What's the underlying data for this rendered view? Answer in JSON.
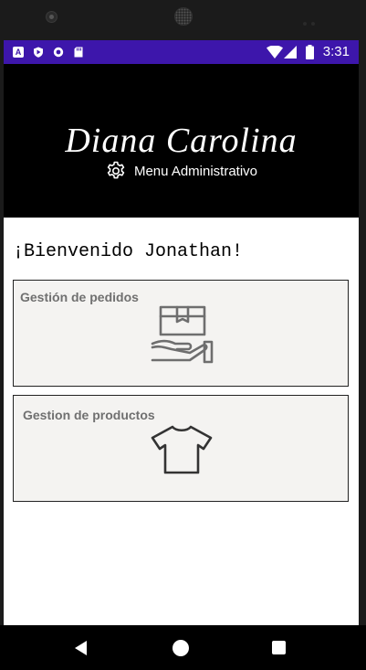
{
  "status_bar": {
    "time": "3:31",
    "left_icons": [
      "a-letter-icon",
      "shield-icon",
      "circle-icon",
      "sd-card-icon"
    ],
    "right_icons": [
      "wifi-icon",
      "signal-icon",
      "battery-icon"
    ],
    "bg_color": "#3d16ab"
  },
  "header": {
    "brand": "Diana Carolina",
    "menu_label": "Menu Administrativo",
    "menu_icon": "gear-icon"
  },
  "main": {
    "welcome": "¡Bienvenido Jonathan!",
    "cards": [
      {
        "title": "Gestión de pedidos",
        "icon": "package-in-hand-icon"
      },
      {
        "title": "Gestion de productos",
        "icon": "tshirt-icon"
      }
    ]
  },
  "nav_bar": {
    "buttons": [
      "back-icon",
      "home-icon",
      "recents-icon"
    ]
  }
}
